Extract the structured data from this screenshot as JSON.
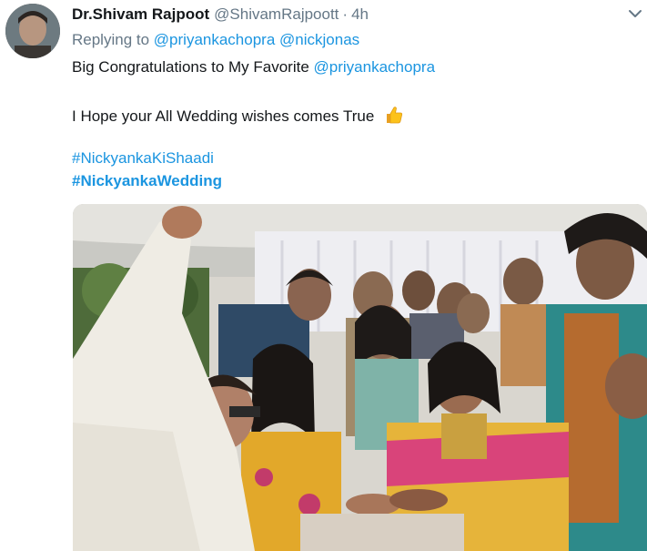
{
  "tweet": {
    "display_name": "Dr.Shivam Rajpoot",
    "handle": "@ShivamRajpoott",
    "separator": "·",
    "time": "4h",
    "replying_prefix": "Replying to",
    "reply_mentions": [
      "@priyankachopra",
      "@nickjonas"
    ],
    "text_line1_prefix": "Big Congratulations to My Favorite",
    "text_line1_mention": "@priyankachopra",
    "text_line2": "I Hope your All Wedding wishes comes True",
    "hashtags": [
      "#NickyankaKiShaadi",
      "#NickyankaWedding"
    ]
  },
  "icons": {
    "menu": "chevron-down-icon",
    "emoji": "thumbs-up-icon"
  },
  "colors": {
    "link": "#1b95e0",
    "secondary_text": "#657786",
    "primary_text": "#14171a"
  }
}
